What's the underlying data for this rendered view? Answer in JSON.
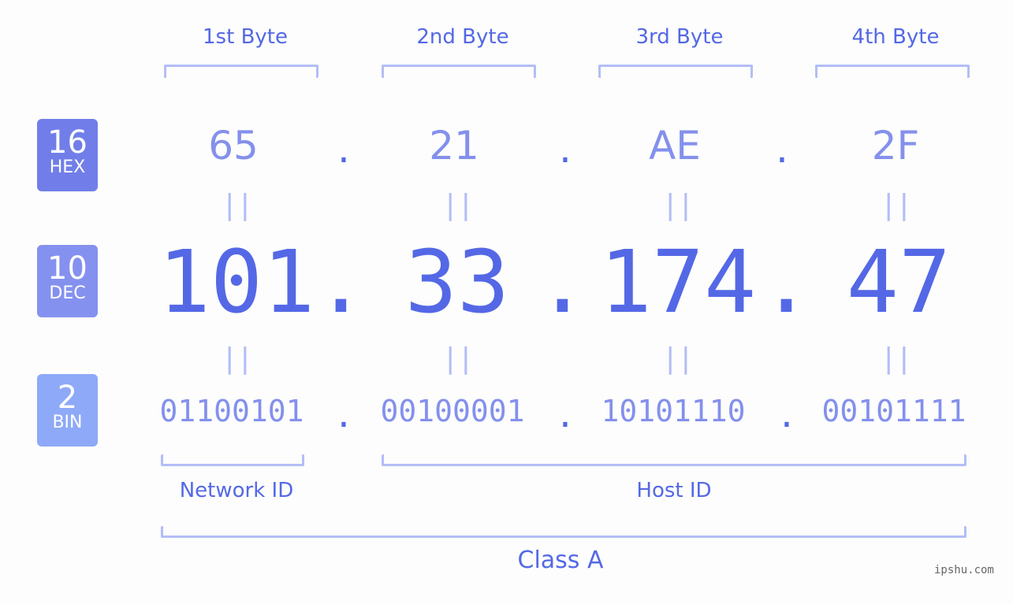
{
  "byte_labels": [
    "1st Byte",
    "2nd Byte",
    "3rd Byte",
    "4th Byte"
  ],
  "badges": {
    "hex": {
      "number": "16",
      "label": "HEX",
      "color": "#717ee9"
    },
    "dec": {
      "number": "10",
      "label": "DEC",
      "color": "#8591ef"
    },
    "bin": {
      "number": "2",
      "label": "BIN",
      "color": "#8ea9f7"
    }
  },
  "hex_octets": [
    "65",
    "21",
    "AE",
    "2F"
  ],
  "dec_octets": [
    "101",
    "33",
    "174",
    "47"
  ],
  "bin_octets": [
    "01100101",
    "00100001",
    "10101110",
    "00101111"
  ],
  "separator": ".",
  "equals": "||",
  "network_id_label": "Network ID",
  "host_id_label": "Host ID",
  "class_label": "Class A",
  "watermark": "ipshu.com",
  "colors": {
    "accent": "#5468e6",
    "light": "#8490ec",
    "bracket": "#b3bdf6"
  }
}
